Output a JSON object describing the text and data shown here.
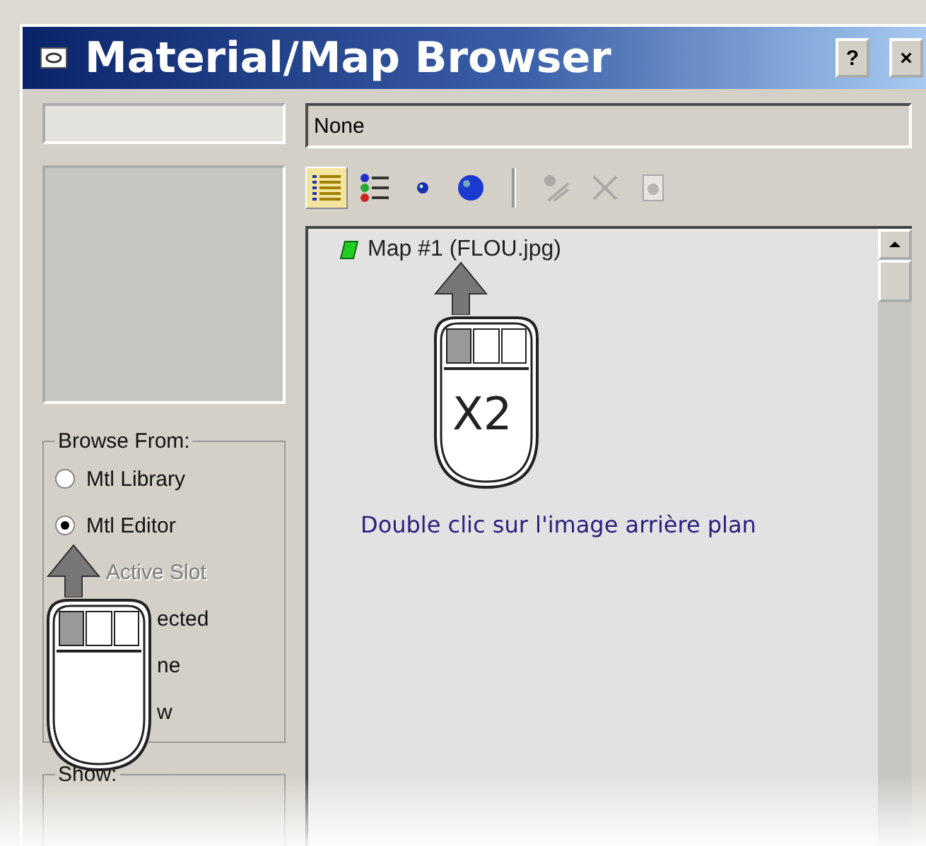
{
  "window": {
    "title": "Material/Map Browser",
    "help_button": "?",
    "close_button": "×"
  },
  "path_field": {
    "value": "None"
  },
  "toolbar": {
    "buttons": [
      {
        "kind": "list",
        "selected": true,
        "disabled": false
      },
      {
        "kind": "tree",
        "selected": false,
        "disabled": false
      },
      {
        "kind": "small-sphere",
        "selected": false,
        "disabled": false
      },
      {
        "kind": "large-sphere",
        "selected": false,
        "disabled": false
      },
      {
        "kind": "assign",
        "selected": false,
        "disabled": true
      },
      {
        "kind": "delete",
        "selected": false,
        "disabled": true
      },
      {
        "kind": "clear",
        "selected": false,
        "disabled": true
      }
    ]
  },
  "list": {
    "items": [
      {
        "label": "Map #1 (FLOU.jpg)"
      }
    ]
  },
  "browse_from": {
    "title": "Browse From:",
    "options": [
      {
        "label": "Mtl Library",
        "selected": false,
        "disabled": false
      },
      {
        "label": "Mtl Editor",
        "selected": true,
        "disabled": false
      },
      {
        "label": "Active Slot",
        "disabled": true
      },
      {
        "label": "ected"
      },
      {
        "label": "ne"
      },
      {
        "label": "w"
      }
    ]
  },
  "show": {
    "title": "Show:"
  },
  "annotations": [
    {
      "kind": "mouse"
    },
    {
      "kind": "mouse",
      "label": "X2"
    },
    {
      "kind": "caption",
      "label": "Double clic sur l'image arrière plan"
    }
  ]
}
